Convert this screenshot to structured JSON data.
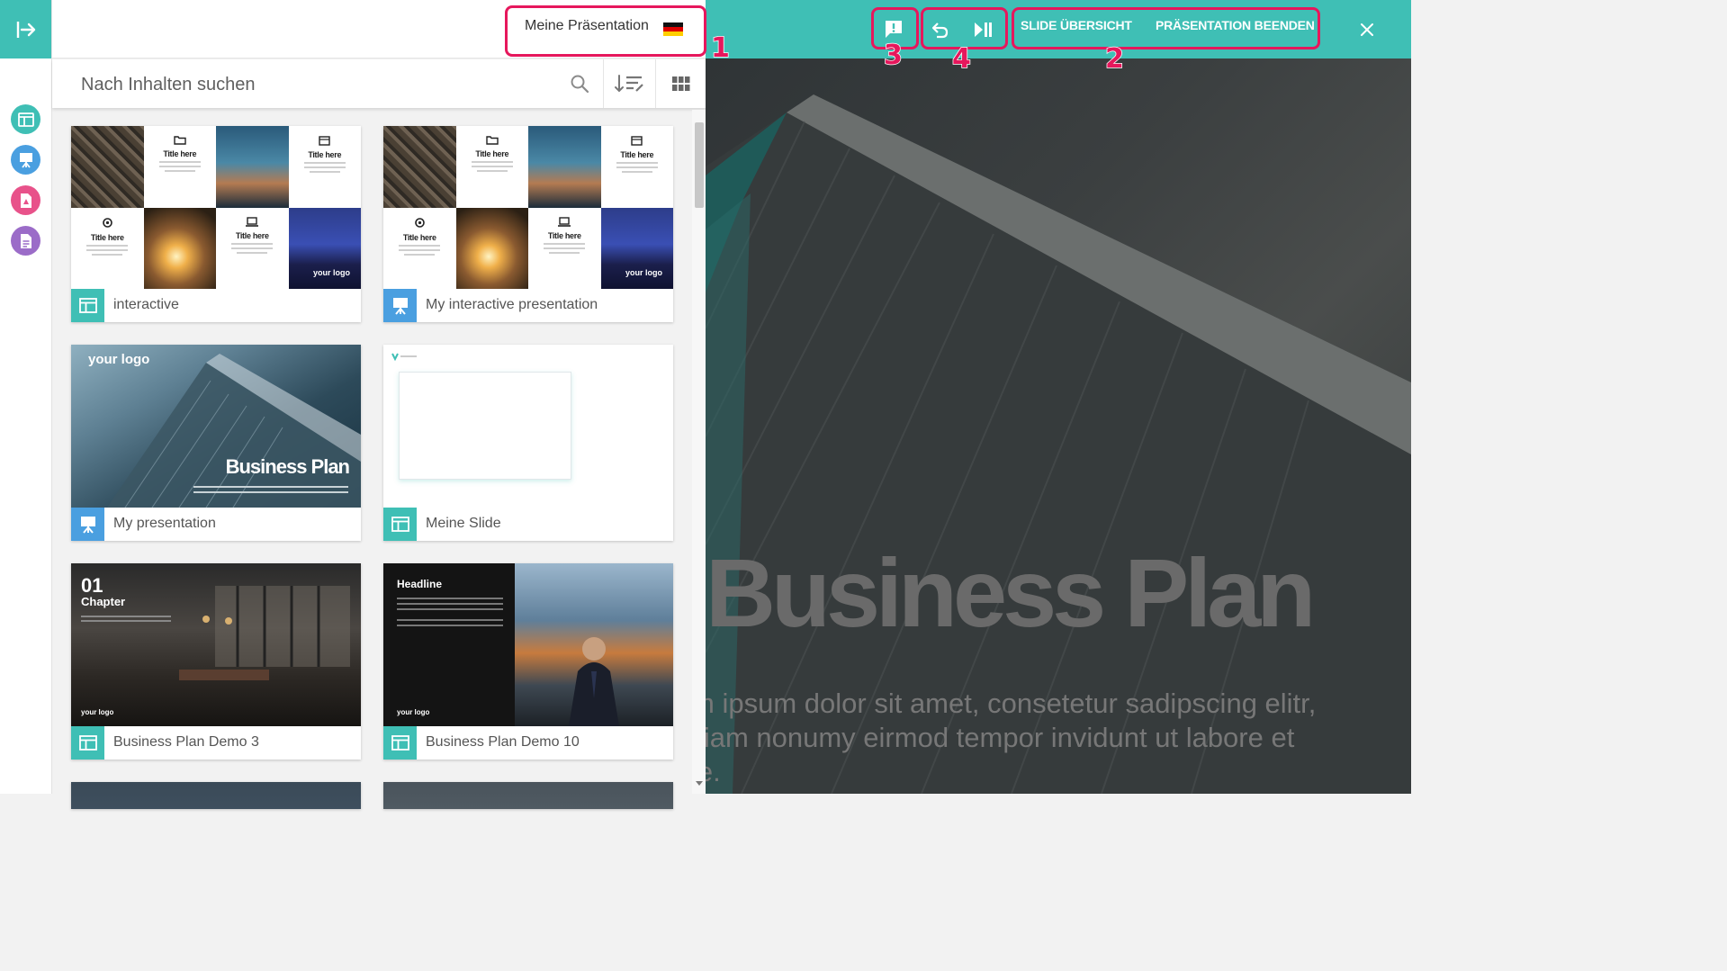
{
  "header": {
    "presentation_name": "Meine Präsentation",
    "language_flag": "flag-de-icon"
  },
  "search": {
    "placeholder": "Nach Inhalten suchen"
  },
  "toolbar": {
    "overview_label": "SLIDE ÜBERSICHT",
    "end_label": "PRÄSENTATION BEENDEN"
  },
  "annotations": {
    "n1": "1",
    "n2": "2",
    "n3": "3",
    "n4": "4"
  },
  "tile_texts": {
    "title_here": "Title here",
    "your_logo": "your logo",
    "chapter_num": "01",
    "chapter": "Chapter",
    "headline": "Headline"
  },
  "cards": [
    {
      "label": "interactive",
      "type": "slide",
      "type_color": "#3fbfb5"
    },
    {
      "label": "My interactive presentation",
      "type": "presentation",
      "type_color": "#4a9fe0"
    },
    {
      "label": "My presentation",
      "type": "presentation",
      "type_color": "#4a9fe0"
    },
    {
      "label": "Meine Slide",
      "type": "slide",
      "type_color": "#3fbfb5"
    },
    {
      "label": "Business Plan Demo 3",
      "type": "slide",
      "type_color": "#3fbfb5"
    },
    {
      "label": "Business Plan Demo 10",
      "type": "slide",
      "type_color": "#3fbfb5"
    }
  ],
  "thumb_text": {
    "logo": "your logo",
    "business_plan": "Business Plan",
    "small_logo": "your logo"
  },
  "slide": {
    "title": "Business Plan",
    "body": "Lorem ipsum dolor sit amet, consetetur sadipscing elitr, sed diam nonumy eirmod tempor invidunt ut labore et dolore."
  },
  "colors": {
    "accent": "#3fbfb5",
    "highlight": "#e6175c",
    "presentation_blue": "#4a9fe0",
    "pdf_pink": "#e8528a",
    "doc_purple": "#9b6cc8"
  },
  "rail_icons": [
    "collapse-arrow-icon",
    "slide-layout-icon",
    "presentation-board-icon",
    "pdf-file-icon",
    "document-icon"
  ]
}
